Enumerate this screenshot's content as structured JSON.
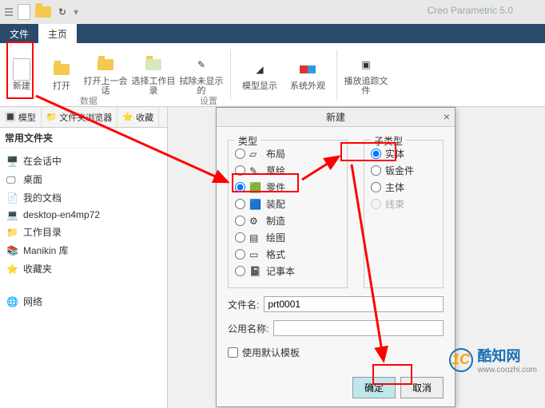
{
  "app_title": "Creo Parametric 5.0",
  "tabs": {
    "file": "文件",
    "home": "主页"
  },
  "ribbon": {
    "new": "新建",
    "open": "打开",
    "open_prev": "打开上一会话",
    "select_wd": "选择工作目录",
    "erase": "拭除未显示的",
    "model_disp": "模型显示",
    "sys_appear": "系统外观",
    "play_trace": "播放追踪文件",
    "grp_data": "数据",
    "grp_set": "设置"
  },
  "left": {
    "tab_model": "模型",
    "tab_folder": "文件夹浏览器",
    "tab_fav": "收藏",
    "header": "常用文件夹",
    "items": [
      "在会话中",
      "桌面",
      "我的文档",
      "desktop-en4mp72",
      "工作目录",
      "Manikin 库",
      "收藏夹",
      "网络"
    ]
  },
  "dlg": {
    "title": "新建",
    "type_hdr": "类型",
    "types": [
      "布局",
      "草绘",
      "零件",
      "装配",
      "制造",
      "绘图",
      "格式",
      "记事本"
    ],
    "subtype_hdr": "子类型",
    "subtypes": [
      "实体",
      "钣金件",
      "主体",
      "线束"
    ],
    "filename_lbl": "文件名:",
    "filename_val": "prt0001",
    "common_lbl": "公用名称:",
    "use_default": "使用默认模板",
    "ok": "确定",
    "cancel": "取消"
  },
  "wm": {
    "brand": "酷知网",
    "url": "www.coozhi.com",
    "mark": "1C"
  }
}
